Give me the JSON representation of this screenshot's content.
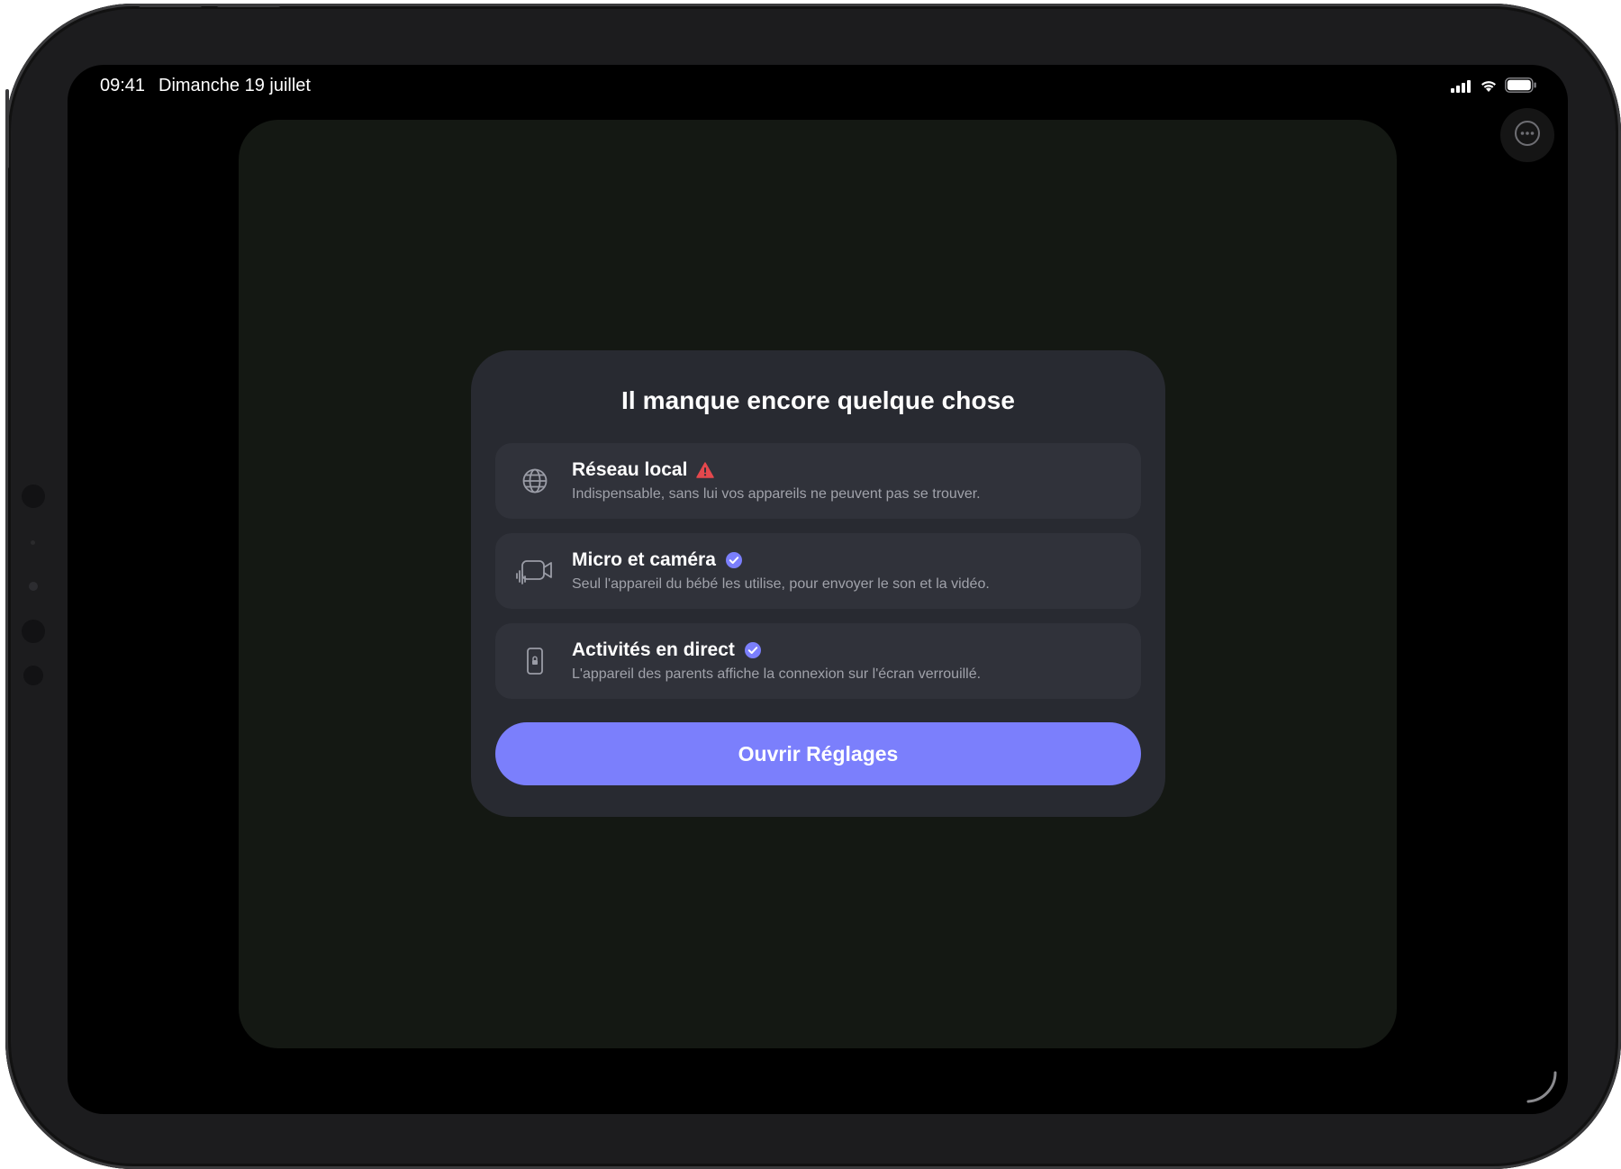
{
  "status_bar": {
    "time": "09:41",
    "date": "Dimanche 19 juillet",
    "icons": [
      "cellular-signal-icon",
      "wifi-icon",
      "battery-icon"
    ]
  },
  "top_right": {
    "icon": "ellipsis-circle-icon"
  },
  "dialog": {
    "title": "Il manque encore quelque chose",
    "permissions": [
      {
        "icon": "globe-icon",
        "title": "Réseau local",
        "description": "Indispensable, sans lui vos appareils ne peuvent pas se trouver.",
        "status": "warning",
        "status_icon": "warning-triangle-icon"
      },
      {
        "icon": "video-camera-icon",
        "title": "Micro et caméra",
        "description": "Seul l'appareil du bébé les utilise, pour envoyer le son et la vidéo.",
        "status": "granted",
        "status_icon": "checkmark-badge-icon"
      },
      {
        "icon": "phone-lock-icon",
        "title": "Activités en direct",
        "description": "L'appareil des parents affiche la connexion sur l'écran verrouillé.",
        "status": "granted",
        "status_icon": "checkmark-badge-icon"
      }
    ],
    "button_label": "Ouvrir Réglages"
  },
  "colors": {
    "accent": "#7b7ffc",
    "warning": "#e5484d",
    "dialog_bg": "#282a31",
    "row_bg": "#30323a",
    "panel_bg": "#141813"
  }
}
